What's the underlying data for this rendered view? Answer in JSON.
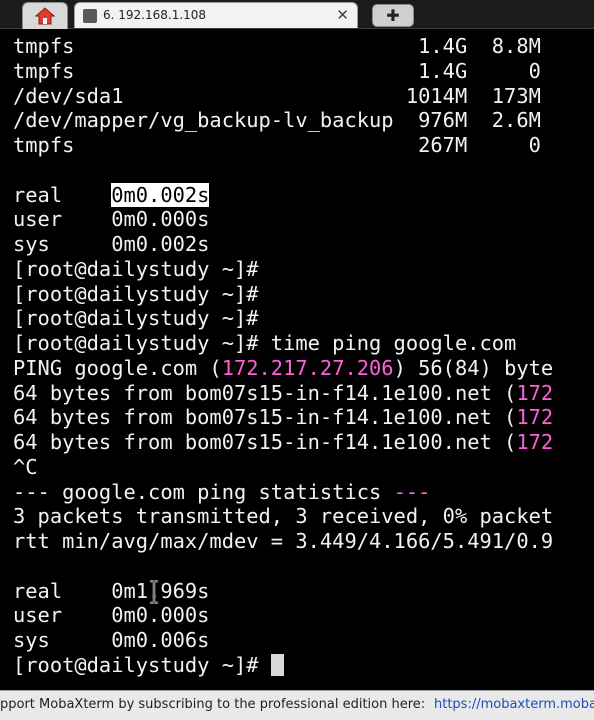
{
  "tabs": {
    "home_icon": "home-icon",
    "session_title": "6. 192.168.1.108",
    "session_icon": "terminal-tab-icon",
    "close_glyph": "✕",
    "new_tab_glyph": "✚"
  },
  "terminal": {
    "df_rows": [
      "tmpfs                            1.4G  8.8M",
      "tmpfs                            1.4G     0",
      "/dev/sda1                       1014M  173M",
      "/dev/mapper/vg_backup-lv_backup  976M  2.6M",
      "tmpfs                            267M     0"
    ],
    "time1": {
      "real_label": "real    ",
      "real_value": "0m0.002s",
      "user": "user    0m0.000s",
      "sys": "sys     0m0.002s"
    },
    "prompts": [
      "[root@dailystudy ~]#",
      "[root@dailystudy ~]#",
      "[root@dailystudy ~]#"
    ],
    "command": "[root@dailystudy ~]# time ping google.com",
    "ping_header": {
      "prefix": "PING google.com (",
      "ip": "172.217.27.206",
      "suffix": ") 56(84) byte"
    },
    "replies": [
      {
        "text": "64 bytes from bom07s15-in-f14.1e100.net (",
        "ip": "172"
      },
      {
        "text": "64 bytes from bom07s15-in-f14.1e100.net (",
        "ip": "172"
      },
      {
        "text": "64 bytes from bom07s15-in-f14.1e100.net (",
        "ip": "172"
      }
    ],
    "interrupt": "^C",
    "stats": {
      "prefix": "--- google.com ping statistics ",
      "suffix": "---",
      "transmitted": "3 packets transmitted, 3 received, 0% packet",
      "rtt": "rtt min/avg/max/mdev = 3.449/4.166/5.491/0.9"
    },
    "time2": {
      "real": "real    0m1.969s",
      "user": "user    0m0.000s",
      "sys": "sys     0m0.006s"
    },
    "final_prompt": "[root@dailystudy ~]#"
  },
  "statusbar": {
    "message": "pport MobaXterm by subscribing to the professional edition here:",
    "link": "https://mobaxterm.moba"
  },
  "colors": {
    "ip_magenta": "#ff5fd7",
    "link_blue": "#1a4dbb"
  }
}
